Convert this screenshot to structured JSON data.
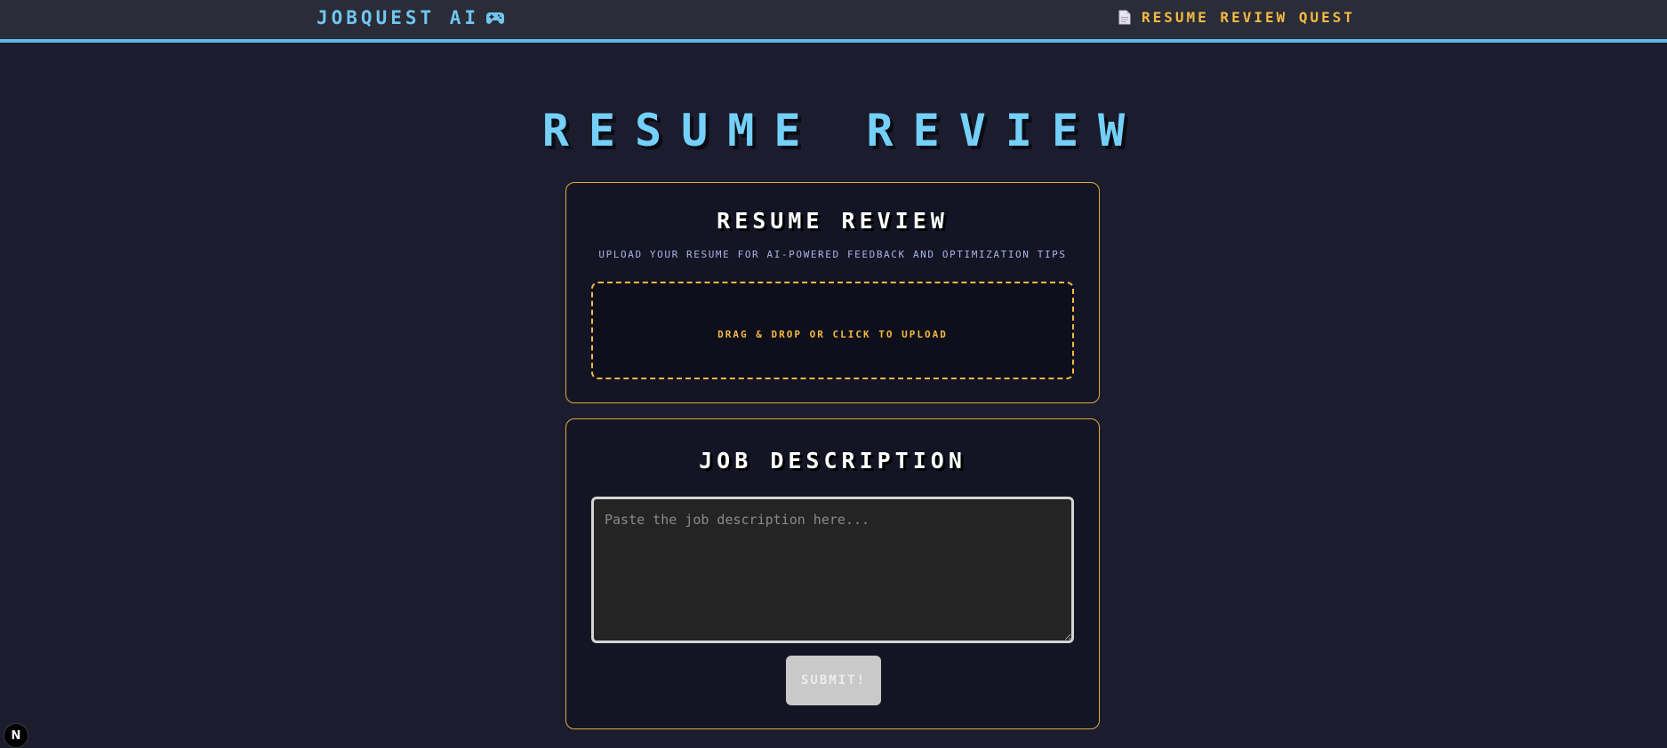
{
  "header": {
    "brand": "JOBQUEST AI",
    "brand_icon": "gamepad-icon",
    "nav_icon": "document-icon",
    "nav_label": "RESUME REVIEW QUEST"
  },
  "page": {
    "title": "RESUME REVIEW"
  },
  "resume_card": {
    "title": "RESUME REVIEW",
    "subtitle": "UPLOAD YOUR RESUME FOR AI-POWERED FEEDBACK AND OPTIMIZATION TIPS",
    "dropzone_label": "DRAG & DROP OR CLICK TO UPLOAD"
  },
  "job_card": {
    "title": "JOB DESCRIPTION",
    "textarea_value": "",
    "textarea_placeholder": "Paste the job description here...",
    "submit_label": "SUBMIT!"
  },
  "dev_badge": {
    "label": "N"
  },
  "colors": {
    "background": "#1b1c2e",
    "topbar": "#2a2c37",
    "accent_blue": "#74d0f8",
    "accent_gold": "#f4b942",
    "card_bg": "#141524"
  }
}
